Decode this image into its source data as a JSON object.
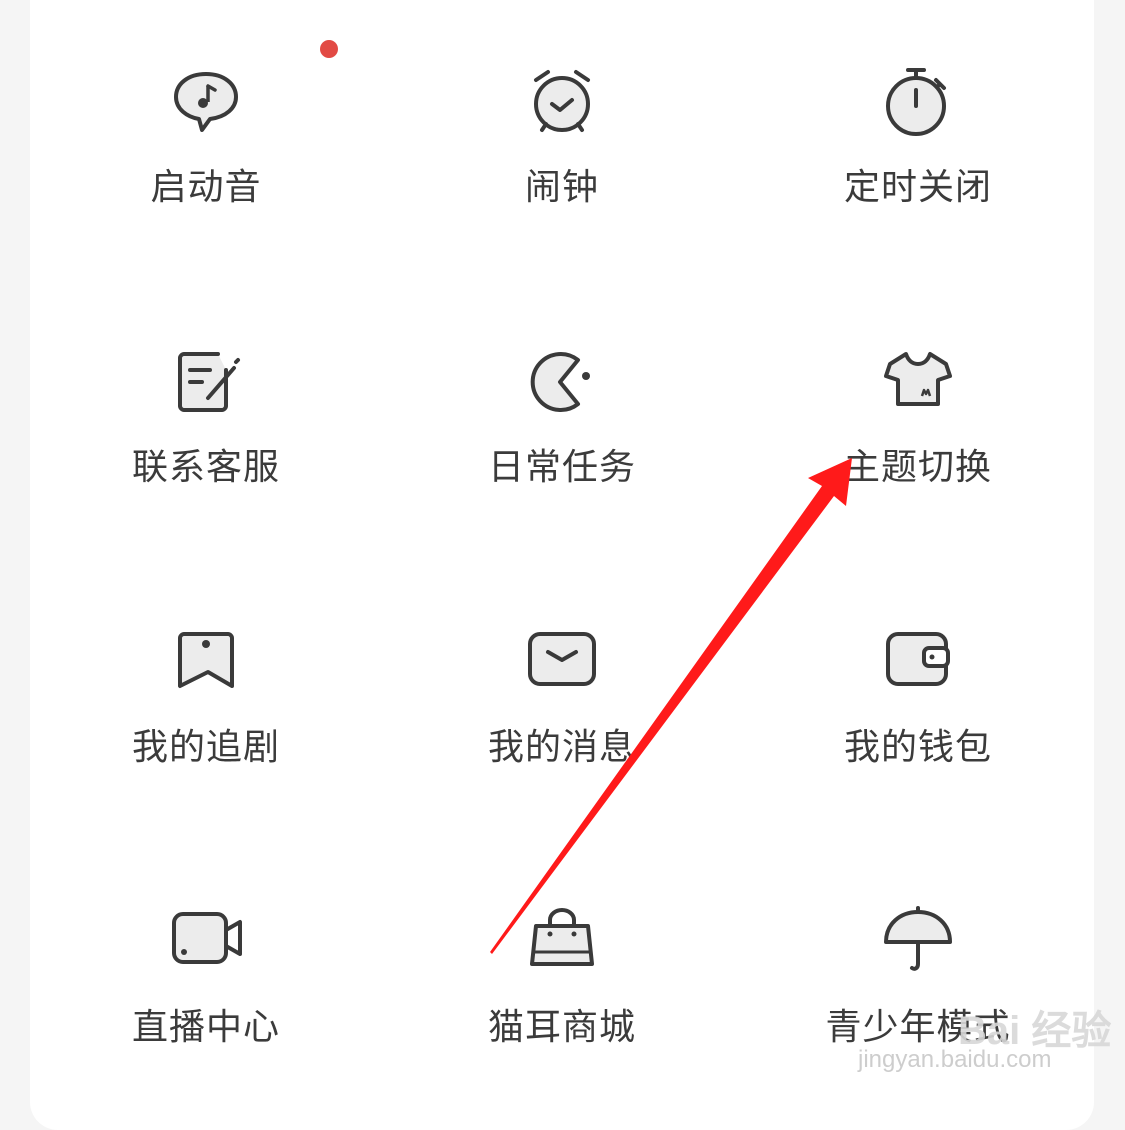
{
  "grid": {
    "items": [
      {
        "label": "启动音",
        "icon": "music-speech-bubble-icon"
      },
      {
        "label": "闹钟",
        "icon": "alarm-clock-icon"
      },
      {
        "label": "定时关闭",
        "icon": "stopwatch-icon"
      },
      {
        "label": "联系客服",
        "icon": "edit-note-icon"
      },
      {
        "label": "日常任务",
        "icon": "pacman-icon"
      },
      {
        "label": "主题切换",
        "icon": "tshirt-icon"
      },
      {
        "label": "我的追剧",
        "icon": "bookmark-icon"
      },
      {
        "label": "我的消息",
        "icon": "message-box-icon"
      },
      {
        "label": "我的钱包",
        "icon": "wallet-icon"
      },
      {
        "label": "直播中心",
        "icon": "video-camera-icon"
      },
      {
        "label": "猫耳商城",
        "icon": "shopping-bag-icon"
      },
      {
        "label": "青少年模式",
        "icon": "umbrella-icon"
      }
    ]
  },
  "watermark": {
    "brand": "Bai 经验",
    "url": "jingyan.baidu.com"
  },
  "colors": {
    "badge": "#e24a44",
    "arrow": "#ff1a1a",
    "icon_stroke": "#3a3a3a",
    "icon_fill": "#ececec"
  }
}
